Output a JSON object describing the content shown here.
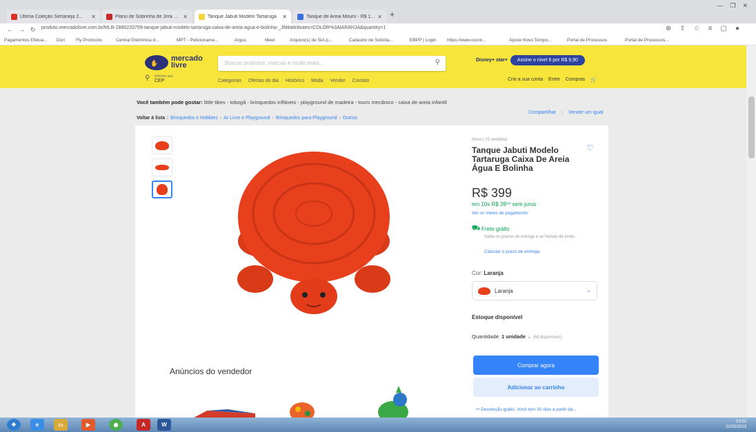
{
  "browser": {
    "tabs": [
      {
        "title": "Última Coleção Sertaneja 2...",
        "favicon_color": "#d93025"
      },
      {
        "title": "Plano de Sobrinha de Jirra 2 m l..",
        "favicon_color": "#c62828"
      },
      {
        "title": "Tanque Jabuti Modelo Tartaruga",
        "favicon_color": "#f5d63d"
      },
      {
        "title": "Tanque de Areia Mouro - R$ 1...",
        "favicon_color": "#3b6fd8"
      }
    ],
    "new_tab": "+",
    "url": "produto.mercadolivre.com.br/MLB-2880220759-tanque-jabuti-modelo-tartaruga-caixa-de-areia-agua-e-bolinha-_JM#attributes=COLOR%3AlARANJA&quantity=1",
    "bookmarks": [
      "Pagamentos Efetua...",
      "Dori",
      "Fly Protocolo",
      "Central Eletrônica d...",
      "MPT - Peticioname...",
      "Argus",
      "Meet",
      "Arquivo(s) de SIA p...",
      "Cadastro de Solicita...",
      "EBPP | Login",
      "https://www.ocont...",
      "Ajuste Novo Tempo...",
      "Portal de Processos",
      "Portal de Processos..."
    ]
  },
  "header": {
    "logo_text_1": "mercado",
    "logo_text_2": "livre",
    "search_placeholder": "Buscar produtos, marcas e muito mais...",
    "promo_logo": "Disney+ star+",
    "promo_label": "Assine o nível 6 por R$ 9,90",
    "cep_small": "Informe seu",
    "cep": "CEP",
    "nav": [
      "Categorias",
      "Ofertas do dia",
      "Histórico",
      "Moda",
      "Vender",
      "Contato"
    ],
    "user": [
      "Crie a sua conta",
      "Entre",
      "Compras"
    ]
  },
  "related": {
    "prefix": "Você também pode gostar:",
    "items": "little tikes - tobogã - brinquedos infláveis - playground de madeira - touro mecânico - caixa de areia infantil"
  },
  "breadcrumb": {
    "back": "Voltar à lista",
    "items": [
      "Brinquedos e Hobbies",
      "Ar Livre e Playground",
      "Brinquedos para Playground",
      "Outros"
    ]
  },
  "sell_links": [
    "Compartilhar",
    "Vender um igual"
  ],
  "product": {
    "condition": "Novo | +5 vendidos",
    "title": "Tanque Jabuti Modelo Tartaruga Caixa De Areia Água E Bolinha",
    "price": "R$ 399",
    "installments": "em 10x R$ 39⁹⁰ sem juros",
    "payment_link": "Ver os meios de pagamento",
    "shipping": "Frete grátis",
    "shipping_note": "Saiba os prazos de entrega e as formas de envio.",
    "shipping_calc": "Calcular o prazo de entrega",
    "color_label": "Cor:",
    "color_value": "Laranja",
    "color_option": "Laranja",
    "stock": "Estoque disponível",
    "qty_label": "Quantidade:",
    "qty_value": "1 unidade",
    "qty_available": "(68 disponíveis)",
    "buy_button": "Comprar agora",
    "cart_button": "Adicionar ao carrinho",
    "returns": "Devolução grátis. Você tem 30 dias a partir da..."
  },
  "seller_ads": "Anúncios do vendedor",
  "taskbar": {
    "time": "13:52",
    "date": "22/05/2023"
  },
  "colors": {
    "header_yellow": "#f7e53b",
    "accent_blue": "#3483fa",
    "turtle_orange": "#e8401c",
    "green": "#00a650"
  }
}
